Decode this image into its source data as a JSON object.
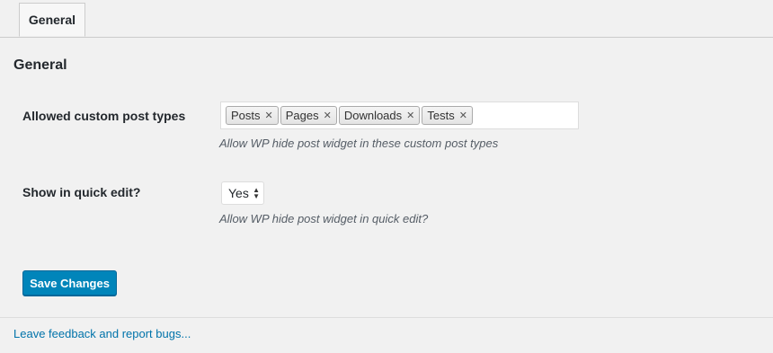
{
  "tabs": [
    {
      "label": "General"
    }
  ],
  "section": {
    "title": "General"
  },
  "fields": {
    "post_types": {
      "label": "Allowed custom post types",
      "tags": [
        {
          "label": "Posts"
        },
        {
          "label": "Pages"
        },
        {
          "label": "Downloads"
        },
        {
          "label": "Tests"
        }
      ],
      "remove_icon": "✕",
      "description": "Allow WP hide post widget in these custom post types"
    },
    "quick_edit": {
      "label": "Show in quick edit?",
      "selected_value": "Yes",
      "description": "Allow WP hide post widget in quick edit?"
    }
  },
  "actions": {
    "save_label": "Save Changes"
  },
  "footer": {
    "feedback_link": "Leave feedback and report bugs..."
  },
  "colors": {
    "primary_button": "#0085ba",
    "link": "#0073aa"
  }
}
